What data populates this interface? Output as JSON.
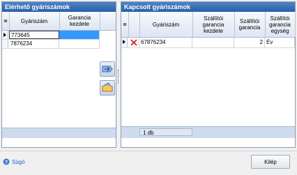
{
  "left_panel": {
    "title": "Elérhető gyáriszámok",
    "columns": [
      "Gyáriszám",
      "Garancia kezdete"
    ],
    "rows": [
      {
        "serial": "773645",
        "warranty_start": ""
      },
      {
        "serial": "7876234",
        "warranty_start": ""
      }
    ]
  },
  "right_panel": {
    "title": "Kapcsolt gyáriszámok",
    "columns": [
      "Gyáriszám",
      "Szállítói garancia kezdete",
      "Szállítói garancia",
      "Szállítói garancia egység"
    ],
    "rows": [
      {
        "serial": "67876234",
        "supplier_start": "",
        "supplier_warranty": "2",
        "unit": "Év"
      }
    ],
    "count": "1 db"
  },
  "side_buttons": {
    "add_icon": "move-right-icon",
    "remove_icon": "move-left-icon"
  },
  "footer": {
    "help_label": "Súgó",
    "exit_label": "Kilép"
  },
  "colors": {
    "title_bar": "#285fa8",
    "selection": "#3399ff"
  }
}
